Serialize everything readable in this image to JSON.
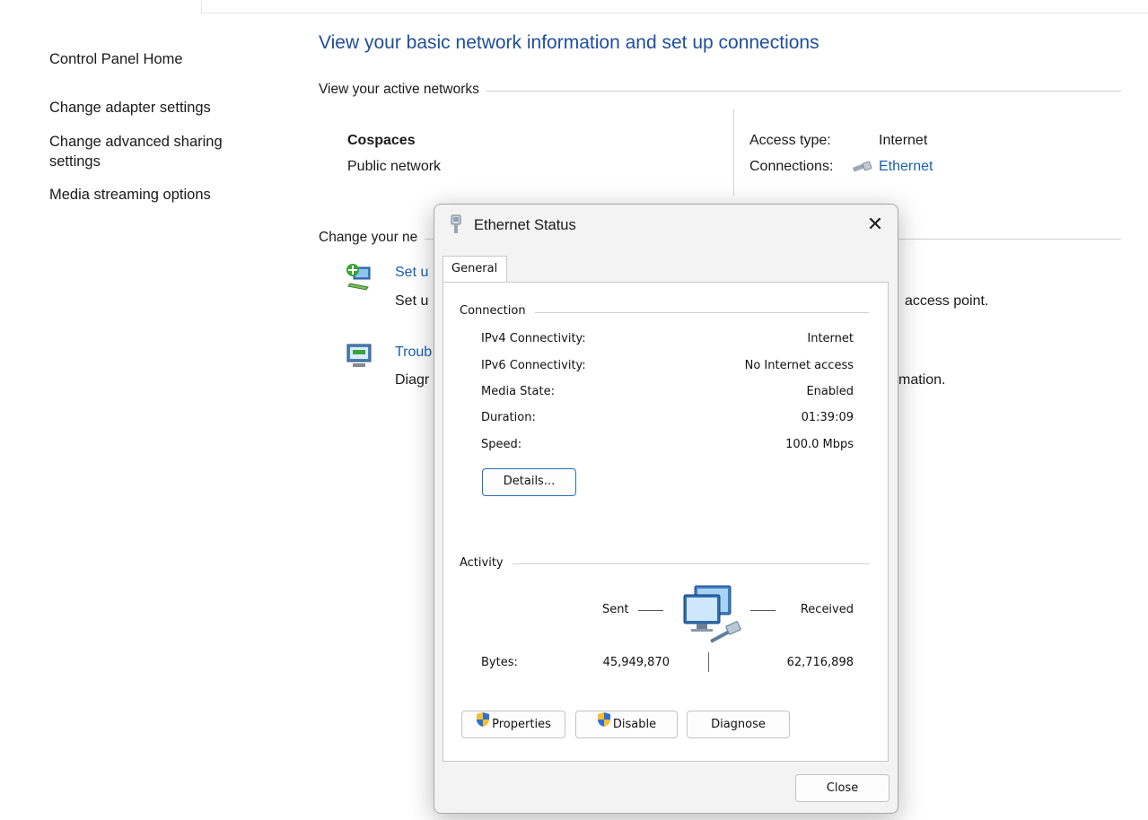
{
  "nav": {
    "home": "Control Panel Home",
    "adapter": "Change adapter settings",
    "sharing": "Change advanced sharing settings",
    "media": "Media streaming options"
  },
  "main": {
    "title": "View your basic network information and set up connections",
    "active_networks_label": "View your active networks",
    "network_name": "Cospaces",
    "network_type": "Public network",
    "access_type_label": "Access type:",
    "access_type_value": "Internet",
    "connections_label": "Connections:",
    "connections_value": "Ethernet",
    "change_label": "Change your ne",
    "task1_link": "Set u",
    "task1_desc": "Set u",
    "task1_desc_tail": "access point.",
    "task2_link": "Troub",
    "task2_desc": "Diagr",
    "task2_desc_tail": "mation."
  },
  "dialog": {
    "title": "Ethernet Status",
    "close_glyph": "✕",
    "tab": "General",
    "connection_group": "Connection",
    "rows": [
      {
        "label": "IPv4 Connectivity:",
        "value": "Internet"
      },
      {
        "label": "IPv6 Connectivity:",
        "value": "No Internet access"
      },
      {
        "label": "Media State:",
        "value": "Enabled"
      },
      {
        "label": "Duration:",
        "value": "01:39:09"
      },
      {
        "label": "Speed:",
        "value": "100.0 Mbps"
      }
    ],
    "details_button": "Details...",
    "activity_group": "Activity",
    "sent_label": "Sent",
    "received_label": "Received",
    "bytes_label": "Bytes:",
    "bytes_sent": "45,949,870",
    "bytes_received": "62,716,898",
    "properties_button": "Properties",
    "disable_button": "Disable",
    "diagnose_button": "Diagnose",
    "close_button": "Close"
  },
  "icons": {
    "network-ethernet": "ethernet-cable-icon",
    "shield": "uac-shield-icon",
    "computers": "network-computers-icon"
  },
  "colors": {
    "title_blue": "#1e4e9c",
    "link_blue": "#1a5fb4",
    "focus_blue": "#2a6ebb"
  }
}
